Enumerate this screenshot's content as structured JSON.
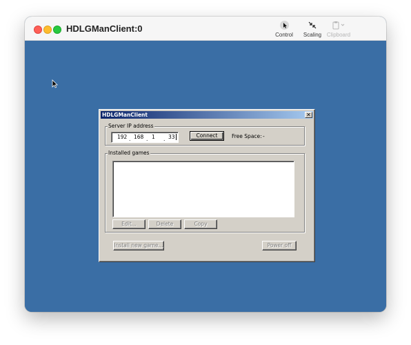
{
  "window": {
    "title": "HDLGManClient:0"
  },
  "toolbar": {
    "control_label": "Control",
    "scaling_label": "Scaling",
    "clipboard_label": "Clipboard"
  },
  "dialog": {
    "title": "HDLGManClient",
    "close_glyph": "✕",
    "server_group_label": "Server IP address",
    "ip_octets": [
      "192",
      "168",
      "1",
      "33"
    ],
    "ip_separator": ".",
    "connect_label": "Connect",
    "free_space_label": "Free Space:",
    "free_space_value": "-",
    "installed_group_label": "Installed games",
    "installed_games": [],
    "edit_label": "Edit...",
    "delete_label": "Delete",
    "copy_label": "Copy",
    "install_label": "Install new game...",
    "poweroff_label": "Power off"
  },
  "colors": {
    "desktop": "#3a6ea5",
    "dialog_face": "#d4d0c8",
    "title_gradient_start": "#0a246a",
    "title_gradient_end": "#a6caf0"
  },
  "icons": {
    "control": "control-icon",
    "scaling": "scaling-icon",
    "clipboard": "clipboard-icon",
    "cursor": "arrow-cursor-icon"
  }
}
